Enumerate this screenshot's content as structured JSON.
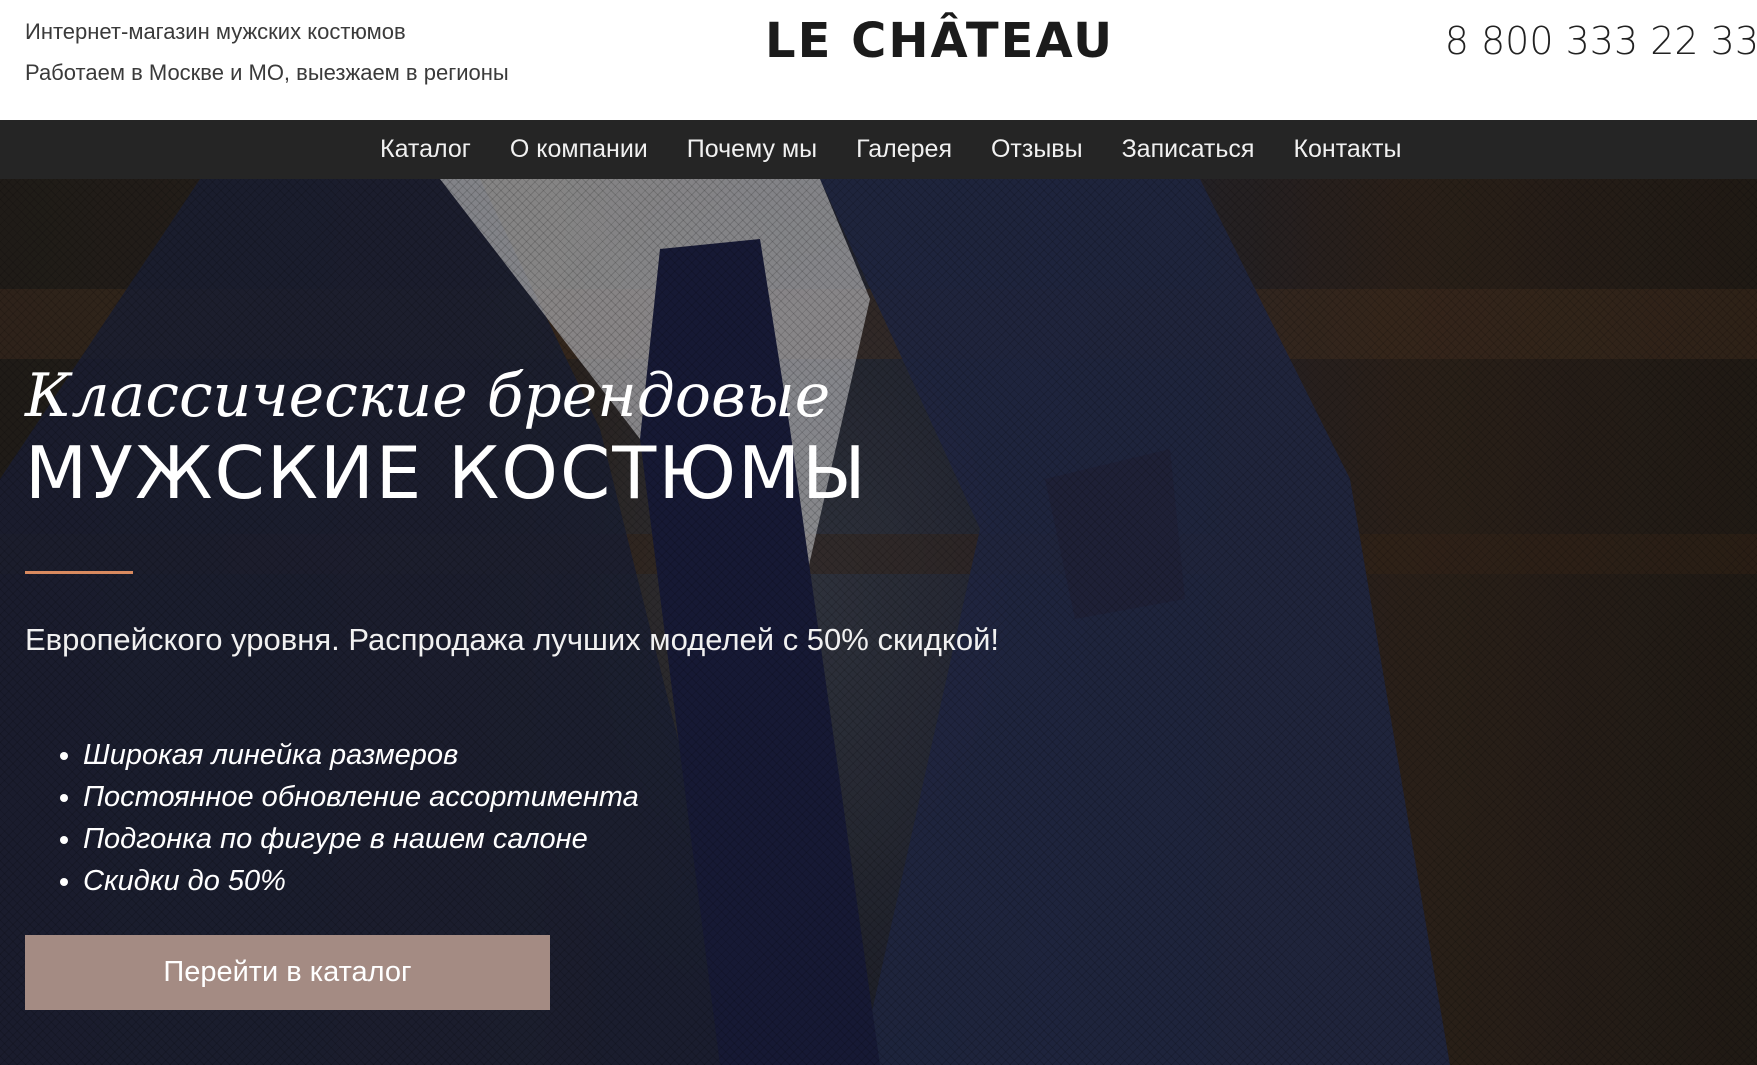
{
  "header": {
    "tagline_line1": "Интернет-магазин мужских костюмов",
    "tagline_line2": "Работаем в Москве и МО, выезжаем в регионы",
    "logo_text": "LE CHÂTEAU",
    "phone": "8 800 333 22 33"
  },
  "nav": {
    "items": [
      {
        "label": "Каталог"
      },
      {
        "label": "О компании"
      },
      {
        "label": "Почему мы"
      },
      {
        "label": "Галерея"
      },
      {
        "label": "Отзывы"
      },
      {
        "label": "Записаться"
      },
      {
        "label": "Контакты"
      }
    ]
  },
  "hero": {
    "title_script": "Классические брендовые",
    "title_main": "МУЖСКИЕ КОСТЮМЫ",
    "subtitle": "Европейского уровня. Распродажа лучших моделей с 50% скидкой!",
    "features": [
      "Широкая линейка размеров",
      "Постоянное обновление ассортимента",
      "Подгонка по фигуре в нашем салоне",
      "Скидки до 50%"
    ],
    "cta_label": "Перейти в каталог"
  },
  "colors": {
    "nav_bg": "#252525",
    "accent_line": "#d98a5f",
    "cta_bg": "#a48b83",
    "logo_accent": "#c0392b"
  }
}
